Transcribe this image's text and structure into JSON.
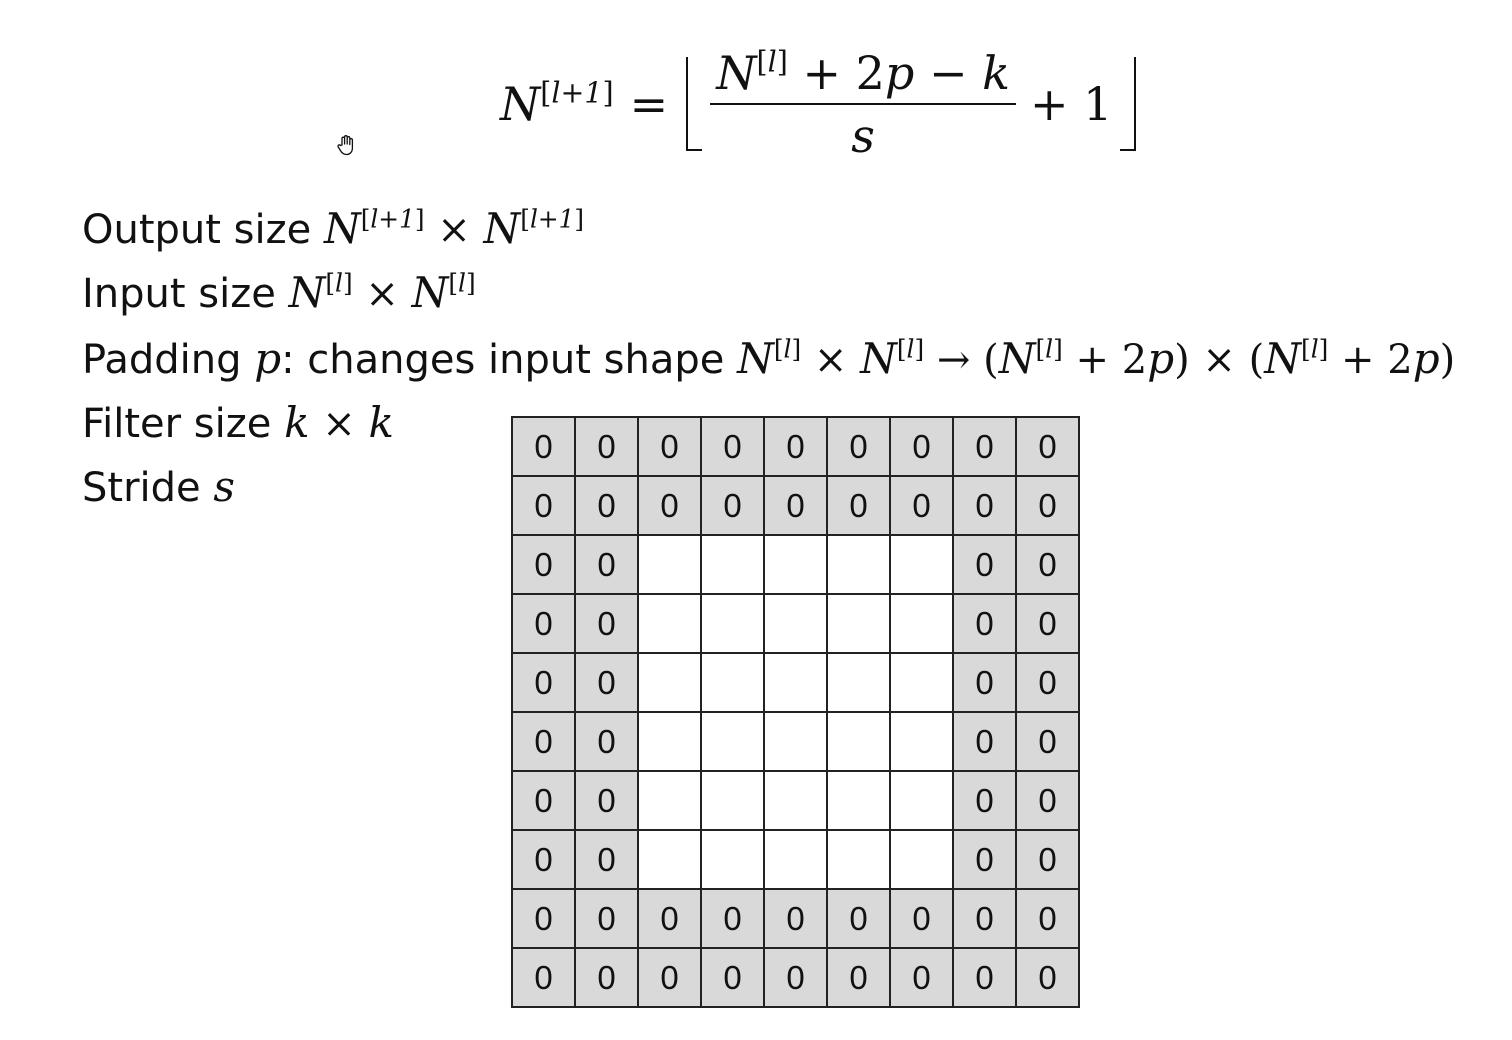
{
  "formula": {
    "lhs_symbol": "N",
    "lhs_superscript": "l+1",
    "equals": "=",
    "numerator": {
      "symbol": "N",
      "superscript": "l",
      "rest_plus": " + 2",
      "p": "p",
      "minus": " − ",
      "k": "k"
    },
    "denominator": "s",
    "tail": "+ 1"
  },
  "definitions": {
    "output": {
      "label": "Output size",
      "sym1": "N",
      "sup1": "l+1",
      "times": "×",
      "sym2": "N",
      "sup2": "l+1"
    },
    "input": {
      "label": "Input size",
      "sym1": "N",
      "sup1": "l",
      "times": "×",
      "sym2": "N",
      "sup2": "l"
    },
    "padding": {
      "label": "Padding",
      "var": "p",
      "colon_text": ": changes input shape",
      "sym1": "N",
      "sup1": "l",
      "times1": "×",
      "sym2": "N",
      "sup2": "l",
      "arrow": "→",
      "open1": "(",
      "sym3": "N",
      "sup3": "l",
      "plus1": " + 2",
      "p1": "p",
      "close1": ")",
      "times2": "×",
      "open2": "(",
      "sym4": "N",
      "sup4": "l",
      "plus2": " + 2",
      "p2": "p",
      "close2": ")"
    },
    "filter": {
      "label": "Filter size",
      "k1": "k",
      "times": "×",
      "k2": "k"
    },
    "stride": {
      "label": "Stride",
      "var": "s"
    }
  },
  "grid": {
    "rows": 10,
    "cols": 9,
    "pad_value": "0",
    "pad_color": "#d9d9d9",
    "input_color": "#ffffff",
    "cells": [
      [
        "0",
        "0",
        "0",
        "0",
        "0",
        "0",
        "0",
        "0",
        "0"
      ],
      [
        "0",
        "0",
        "0",
        "0",
        "0",
        "0",
        "0",
        "0",
        "0"
      ],
      [
        "0",
        "0",
        "",
        "",
        "",
        "",
        "",
        "0",
        "0"
      ],
      [
        "0",
        "0",
        "",
        "",
        "",
        "",
        "",
        "0",
        "0"
      ],
      [
        "0",
        "0",
        "",
        "",
        "",
        "",
        "",
        "0",
        "0"
      ],
      [
        "0",
        "0",
        "",
        "",
        "",
        "",
        "",
        "0",
        "0"
      ],
      [
        "0",
        "0",
        "",
        "",
        "",
        "",
        "",
        "0",
        "0"
      ],
      [
        "0",
        "0",
        "",
        "",
        "",
        "",
        "",
        "0",
        "0"
      ],
      [
        "0",
        "0",
        "0",
        "0",
        "0",
        "0",
        "0",
        "0",
        "0"
      ],
      [
        "0",
        "0",
        "0",
        "0",
        "0",
        "0",
        "0",
        "0",
        "0"
      ]
    ]
  },
  "cursor_icon": "hand-pointer-icon"
}
